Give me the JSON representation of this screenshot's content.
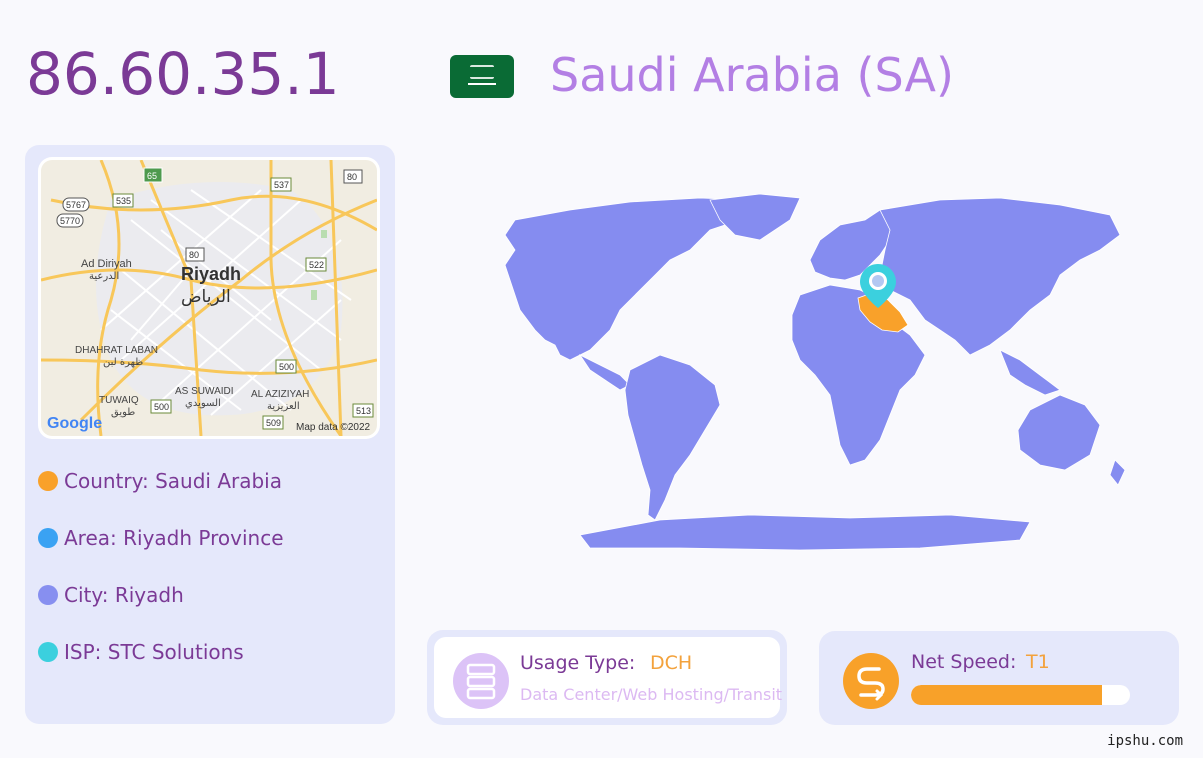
{
  "ip": "86.60.35.1",
  "country_title": "Saudi Arabia (SA)",
  "map": {
    "city_en": "Riyadh",
    "city_ar": "الرياض",
    "labels": [
      {
        "en": "Ad Diriyah",
        "ar": "الدرعية"
      },
      {
        "en": "DHAHRAT LABAN",
        "ar": "ظهرة لبن"
      },
      {
        "en": "AS SUWAIDI",
        "ar": "السويدي"
      },
      {
        "en": "TUWAIQ",
        "ar": "طويق"
      },
      {
        "en": "AL AZIZIYAH",
        "ar": "العزيزية"
      }
    ],
    "road_shields": [
      "65",
      "537",
      "80",
      "535",
      "5767",
      "5770",
      "80",
      "522",
      "500",
      "500",
      "509",
      "513"
    ],
    "attribution": "Map data ©2022",
    "logo": "Google"
  },
  "info": [
    {
      "label": "Country: Saudi Arabia",
      "color": "#f9a12a"
    },
    {
      "label": "Area: Riyadh Province",
      "color": "#3aa2f3"
    },
    {
      "label": "City: Riyadh",
      "color": "#878ff0"
    },
    {
      "label": "ISP: STC Solutions",
      "color": "#3bd0de"
    }
  ],
  "usage": {
    "label": "Usage Type:",
    "value": "DCH",
    "description": "Data Center/Web Hosting/Transit",
    "icon": "server-icon"
  },
  "speed": {
    "label": "Net Speed:",
    "value": "T1",
    "level": 0.87,
    "icon": "speed-route-icon"
  },
  "colors": {
    "accent": "#7b3a96",
    "country_title": "#b37fe4",
    "world_land": "#858cf0",
    "highlight_country": "#f9a12a",
    "marker": "#3bd0de"
  },
  "watermark": "ipshu.com"
}
